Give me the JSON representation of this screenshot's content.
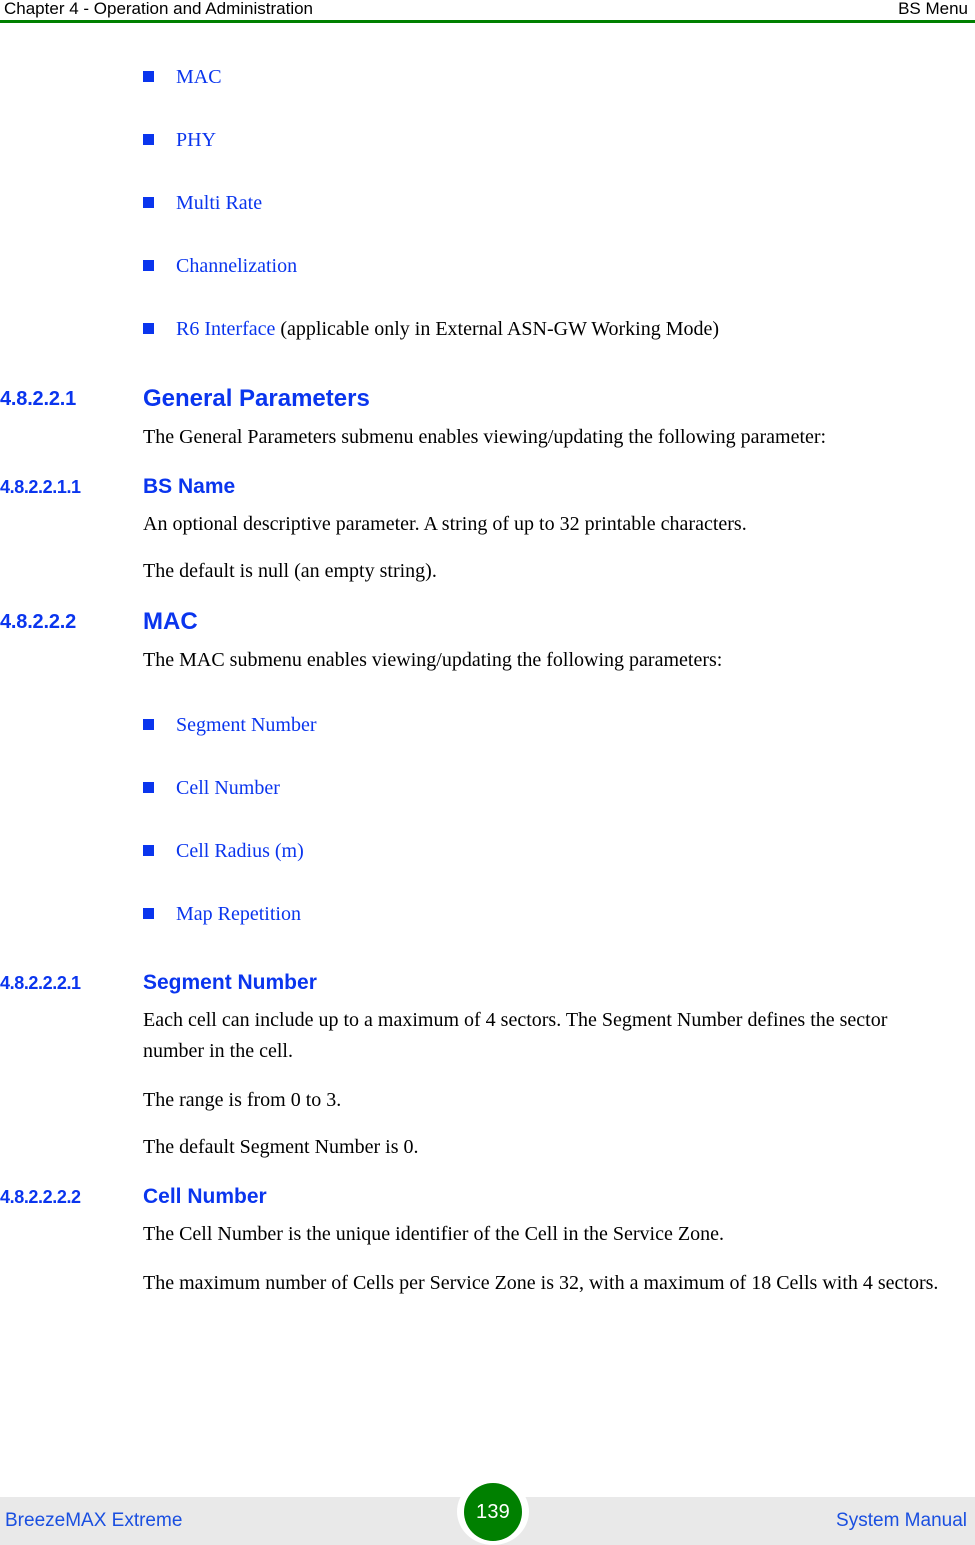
{
  "header": {
    "left": "Chapter 4 - Operation and Administration",
    "right": "BS Menu",
    "rule_color": "#008000"
  },
  "colors": {
    "link_blue": "#0A35EE",
    "heading_blue": "#0A35EE",
    "footer_blue": "#1A4FE0",
    "rule_green": "#008000",
    "badge_green": "#008000",
    "footer_band": "#e9e9e9",
    "body_black": "#000000"
  },
  "submenu_list": [
    {
      "label": "MAC",
      "note": ""
    },
    {
      "label": "PHY",
      "note": ""
    },
    {
      "label": "Multi Rate",
      "note": ""
    },
    {
      "label": "Channelization",
      "note": ""
    },
    {
      "label": "R6 Interface",
      "note": " (applicable only in External ASN-GW Working Mode)"
    }
  ],
  "sections": {
    "general_parameters": {
      "number": "4.8.2.2.1",
      "title": "General Parameters",
      "paragraphs": [
        "The General Parameters submenu enables viewing/updating the following parameter:"
      ]
    },
    "bs_name": {
      "number": "4.8.2.2.1.1",
      "title": "BS Name",
      "paragraphs": [
        "An optional descriptive parameter. A string of up to 32 printable characters.",
        "The default is null (an empty string)."
      ]
    },
    "mac": {
      "number": "4.8.2.2.2",
      "title": "MAC",
      "paragraphs": [
        "The MAC submenu enables viewing/updating the following parameters:"
      ],
      "list": [
        {
          "label": "Segment Number"
        },
        {
          "label": "Cell Number"
        },
        {
          "label": "Cell Radius (m)"
        },
        {
          "label": "Map Repetition"
        }
      ]
    },
    "segment_number": {
      "number": "4.8.2.2.2.1",
      "title": "Segment Number",
      "paragraphs": [
        "Each cell can include up to a maximum of 4 sectors. The Segment Number defines the sector number in the cell.",
        "The range is from 0 to 3.",
        "The default Segment Number is 0."
      ]
    },
    "cell_number": {
      "number": "4.8.2.2.2.2",
      "title": "Cell Number",
      "paragraphs": [
        "The Cell Number is the unique identifier of the Cell in the Service Zone.",
        "The maximum number of Cells per Service Zone is 32, with a maximum of 18 Cells with 4 sectors."
      ]
    }
  },
  "footer": {
    "left": "BreezeMAX Extreme",
    "page_number": "139",
    "right": "System Manual"
  }
}
